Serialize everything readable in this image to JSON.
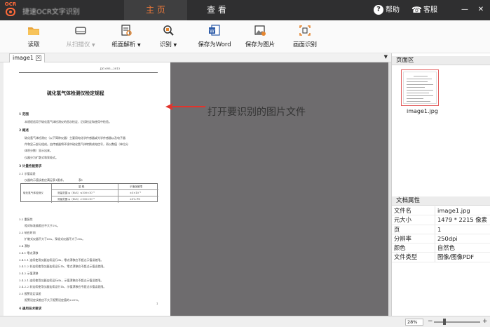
{
  "app": {
    "logo_text": "OCR",
    "title": "捷速OCR文字识别"
  },
  "main_tabs": [
    {
      "label": "主 页"
    },
    {
      "label": "查 看"
    }
  ],
  "title_actions": {
    "help": "帮助",
    "service": "客服"
  },
  "window_controls": {
    "minimize": "—",
    "close": "✕"
  },
  "toolbar": [
    {
      "label": "读取",
      "icon": "folder-icon",
      "enabled": true
    },
    {
      "label": "从扫描仪",
      "icon": "scanner-icon",
      "enabled": false,
      "dropdown": true
    },
    {
      "label": "纸面解析",
      "icon": "page-analyze-icon",
      "enabled": true,
      "dropdown": true
    },
    {
      "label": "识别",
      "icon": "recognize-icon",
      "enabled": true,
      "dropdown": true
    },
    {
      "label": "保存为Word",
      "icon": "word-icon",
      "enabled": true
    },
    {
      "label": "保存为图片",
      "icon": "save-image-icon",
      "enabled": true
    },
    {
      "label": "画面识别",
      "icon": "screen-capture-icon",
      "enabled": true
    }
  ],
  "doc_tab": {
    "label": "image1",
    "dropdown": "▼"
  },
  "document": {
    "doc_number": "JJG 693—2013",
    "title": "硫化氢气体检测仪检定规程",
    "lines": [
      {
        "text": "1  范围",
        "head": true
      },
      {
        "text": "本规程适用于硫化氢气体检测仪的首次检定、后续检定和使用中检验。"
      },
      {
        "text": "2  概述",
        "head": true
      },
      {
        "text": "硫化氢气体检测仪（以下简称仪器）主要用电化学传感器或光学传感器以及电子器"
      },
      {
        "text": "件和显示部分组成。由传感器将环境中硫化氢气体转换成电信号，再以数值（单位分"
      },
      {
        "text": "体积分数）显示出来。"
      },
      {
        "text": "仪器分为扩散式和泵吸式。"
      },
      {
        "text": "3  计量性能要求",
        "head": true
      },
      {
        "text": "3.1  示值误差"
      },
      {
        "text": "仪器的示值误差应满足表1要求。"
      },
      {
        "text": "3.2  重复性"
      },
      {
        "text": "相对标准偏差应不大于2%。"
      },
      {
        "text": "3.3  响应时间"
      },
      {
        "text": "扩散式仪器不大于60s，泵吸式仪器不大于30s。"
      },
      {
        "text": "3.4  漂移"
      },
      {
        "text": "3.4.1  零点漂移"
      },
      {
        "text": "3.4.1.1  连续使用仪器连续运行6h，零点漂移应不超过示值误差限。"
      },
      {
        "text": "3.4.1.2  非连续使用仪器连续运行1h，零点漂移应不超过示值误差限。"
      },
      {
        "text": "3.4.2  示值漂移"
      },
      {
        "text": "3.4.2.1  连续使用仪器连续运行6h，示值漂移应不超过示值误差限。"
      },
      {
        "text": "3.4.2.2  非连续使用仪器连续运行1h，示值漂移应不超过示值误差限。"
      },
      {
        "text": "3.5  报警设定误差"
      },
      {
        "text": "报警设定误差应不大于报警设定值的±20%。"
      },
      {
        "text": "4  通用技术要求",
        "head": true
      },
      {
        "text": "4.1  外观"
      }
    ],
    "table": {
      "caption": "表1",
      "header": [
        "量 程",
        "示值误差限"
      ],
      "row_label": "硫化氢气体检测仪",
      "rows": [
        [
          "测量范围 φ（H₂S）≤100×10⁻⁶",
          "±5×10⁻⁶"
        ],
        [
          "测量范围 φ（H₂S）>100×10⁻⁶",
          "±5% FS"
        ]
      ]
    },
    "page_number": "1"
  },
  "annotation": {
    "text": "打开要识别的图片文件"
  },
  "pages_panel": {
    "header": "页面区",
    "thumbnails": [
      {
        "label": "image1.jpg"
      }
    ]
  },
  "properties_panel": {
    "header": "文档属性",
    "rows": [
      {
        "key": "文件名",
        "value": "image1.jpg"
      },
      {
        "key": "元大小",
        "value": "1479 * 2215 像素"
      },
      {
        "key": "页",
        "value": "1"
      },
      {
        "key": "分辨率",
        "value": "250dpi"
      },
      {
        "key": "颜色",
        "value": "自然色"
      },
      {
        "key": "文件类型",
        "value": "图像/图像PDF"
      }
    ]
  },
  "status": {
    "zoom": "28%",
    "zoom_level": 0.22
  },
  "colors": {
    "accent": "#f07a3a",
    "titlebar": "#2f2f30",
    "canvas": "#6e6c6e",
    "annotation_arrow": "#e2342c"
  }
}
